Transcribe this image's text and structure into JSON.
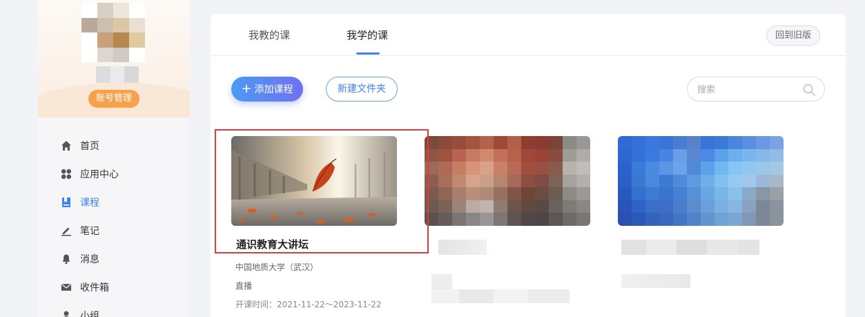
{
  "sidebar": {
    "account_label": "账号管理",
    "nav": [
      {
        "label": "首页",
        "icon": "home-icon"
      },
      {
        "label": "应用中心",
        "icon": "apps-icon"
      },
      {
        "label": "课程",
        "icon": "course-icon",
        "active": true
      },
      {
        "label": "笔记",
        "icon": "note-icon"
      },
      {
        "label": "消息",
        "icon": "bell-icon"
      },
      {
        "label": "收件箱",
        "icon": "mail-icon"
      },
      {
        "label": "小组",
        "icon": "group-icon"
      }
    ]
  },
  "header": {
    "tabs": [
      {
        "label": "我教的课"
      },
      {
        "label": "我学的课",
        "active": true
      }
    ],
    "old_version_label": "回到旧版"
  },
  "toolbar": {
    "add_course_label": "添加课程",
    "new_folder_label": "新建文件夹",
    "search_placeholder": "搜索"
  },
  "courses": [
    {
      "title": "通识教育大讲坛",
      "school": "中国地质大学（武汉）",
      "type": "直播",
      "date_label": "开课时间：2021-11-22～2023-11-22"
    }
  ],
  "colors": {
    "accent": "#3d82f0",
    "account_badge": "#f6a14b",
    "highlight": "#e03a3a"
  }
}
